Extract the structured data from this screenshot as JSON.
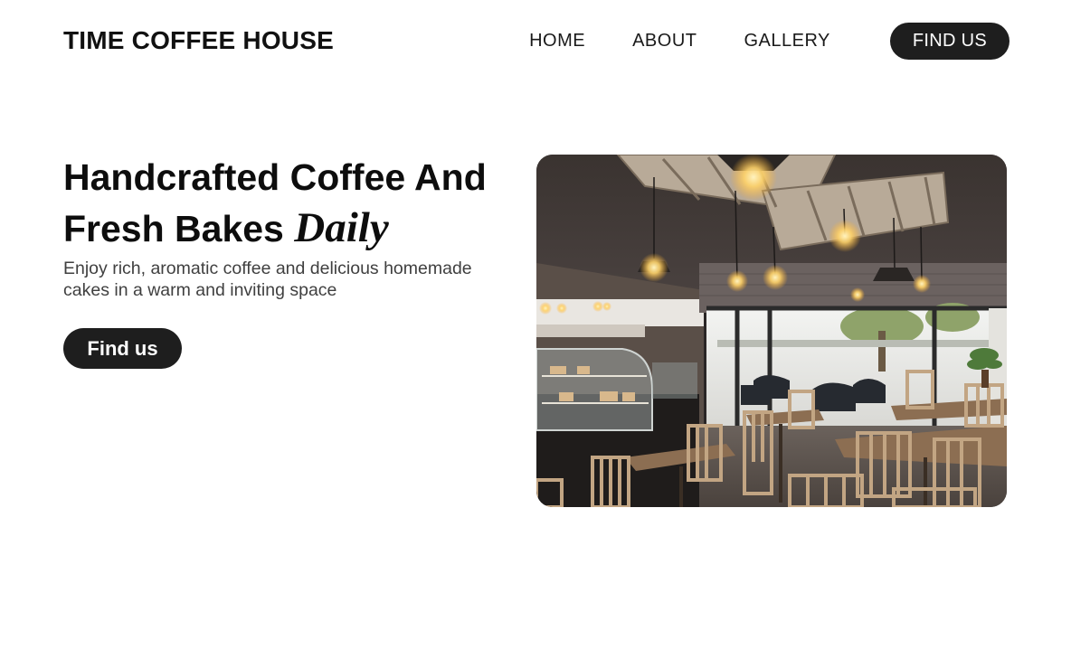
{
  "brand": {
    "name": "TIME COFFEE HOUSE"
  },
  "nav": {
    "links": [
      {
        "label": "HOME"
      },
      {
        "label": "ABOUT"
      },
      {
        "label": "GALLERY"
      }
    ],
    "cta_label": "FIND US"
  },
  "hero": {
    "title_line1": "Handcrafted Coffee And",
    "title_line2": "Fresh Bakes",
    "title_accent": "Daily",
    "subtitle": "Enjoy rich, aromatic coffee and delicious homemade cakes in a warm and inviting space",
    "cta_label": "Find us",
    "image_subject": "cafe-interior-photo"
  },
  "colors": {
    "background": "#ffffff",
    "text": "#111111",
    "button_bg": "#1e1e1e",
    "button_text": "#ffffff",
    "subtitle_text": "#404040"
  }
}
